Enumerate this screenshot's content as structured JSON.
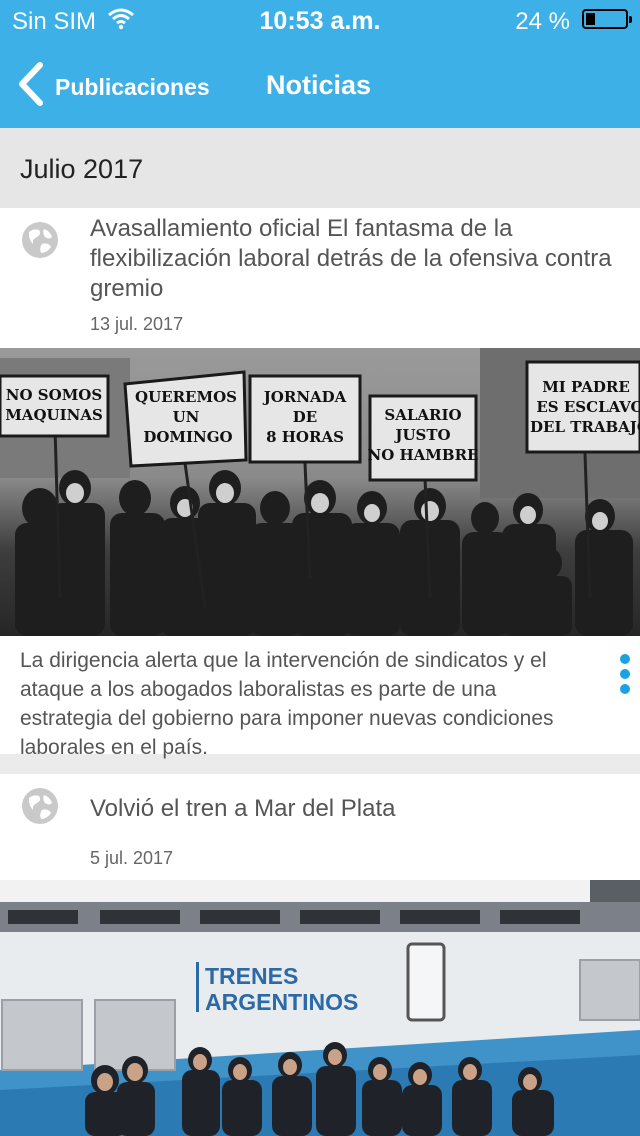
{
  "status_bar": {
    "carrier": "Sin SIM",
    "time": "10:53 a.m.",
    "battery_percent": "24 %"
  },
  "nav": {
    "back_label": "Publicaciones",
    "title": "Noticias"
  },
  "section": {
    "label": "Julio 2017"
  },
  "articles": [
    {
      "title": "Avasallamiento oficial El fantasma de la flexibilización laboral detrás de la ofensiva contra gremio",
      "date": "13 jul. 2017",
      "summary": "La dirigencia alerta que la intervención de sindicatos y el ataque a los abogados laboralistas es parte de una estrategia del gobierno para imponer nuevas condiciones laborales en el país.",
      "signs": [
        "NO SOMOS",
        "MAQUINAS",
        "QUEREMOS",
        "UN",
        "DOMINGO",
        "JORNADA",
        "DE",
        "8 HORAS",
        "SALARIO",
        "JUSTO",
        "NO HAMBRE",
        "MI PADRE",
        "ES ESCLAVO",
        "DEL TRABAJO"
      ]
    },
    {
      "title": "Volvió el tren a Mar del Plata",
      "date": "5 jul. 2017",
      "train_logo": [
        "TRENES",
        "ARGENTINOS"
      ]
    }
  ],
  "colors": {
    "nav_bar": "#3db0e8",
    "accent": "#1aa3e0"
  }
}
